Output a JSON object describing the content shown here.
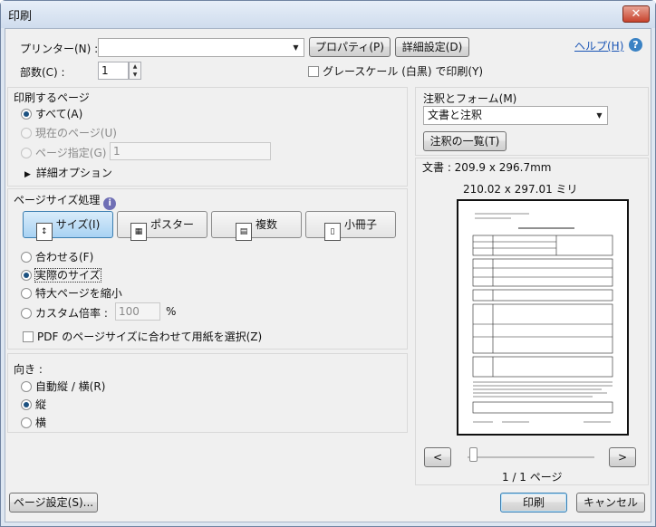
{
  "window": {
    "title": "印刷",
    "close_label": "✕"
  },
  "printer": {
    "label": "プリンター(N) :",
    "value": "",
    "properties_button": "プロパティ(P)",
    "advanced_button": "詳細設定(D)",
    "help_link": "ヘルプ(H)"
  },
  "copies": {
    "label": "部数(C) :",
    "value": "1",
    "grayscale_label": "グレースケール (白黒) で印刷(Y)"
  },
  "pages_to_print": {
    "heading": "印刷するページ",
    "all": "すべて(A)",
    "current": "現在のページ(U)",
    "range": "ページ指定(G)",
    "range_value": "1",
    "more_options": "詳細オプション"
  },
  "page_sizing": {
    "heading": "ページサイズ処理",
    "buttons": [
      "サイズ(I)",
      "ポスター",
      "複数",
      "小冊子"
    ],
    "fit": "合わせる(F)",
    "actual_size": "実際のサイズ",
    "shrink": "特大ページを縮小",
    "custom_scale": "カスタム倍率 :",
    "custom_value": "100",
    "percent": "%",
    "choose_paper": "PDF のページサイズに合わせて用紙を選択(Z)"
  },
  "orientation": {
    "heading": "向き :",
    "auto": "自動縦 / 横(R)",
    "portrait": "縦",
    "landscape": "横"
  },
  "comments_forms": {
    "heading": "注釈とフォーム(M)",
    "value": "文書と注釈",
    "summary_button": "注釈の一覧(T)"
  },
  "preview": {
    "doc_size": "文書 : 209.9 x 296.7mm",
    "paper_size": "210.02 x 297.01 ミリ",
    "prev": "<",
    "next": ">",
    "page_info": "1 / 1 ページ"
  },
  "footer": {
    "page_setup": "ページ設定(S)...",
    "print": "印刷",
    "cancel": "キャンセル"
  }
}
